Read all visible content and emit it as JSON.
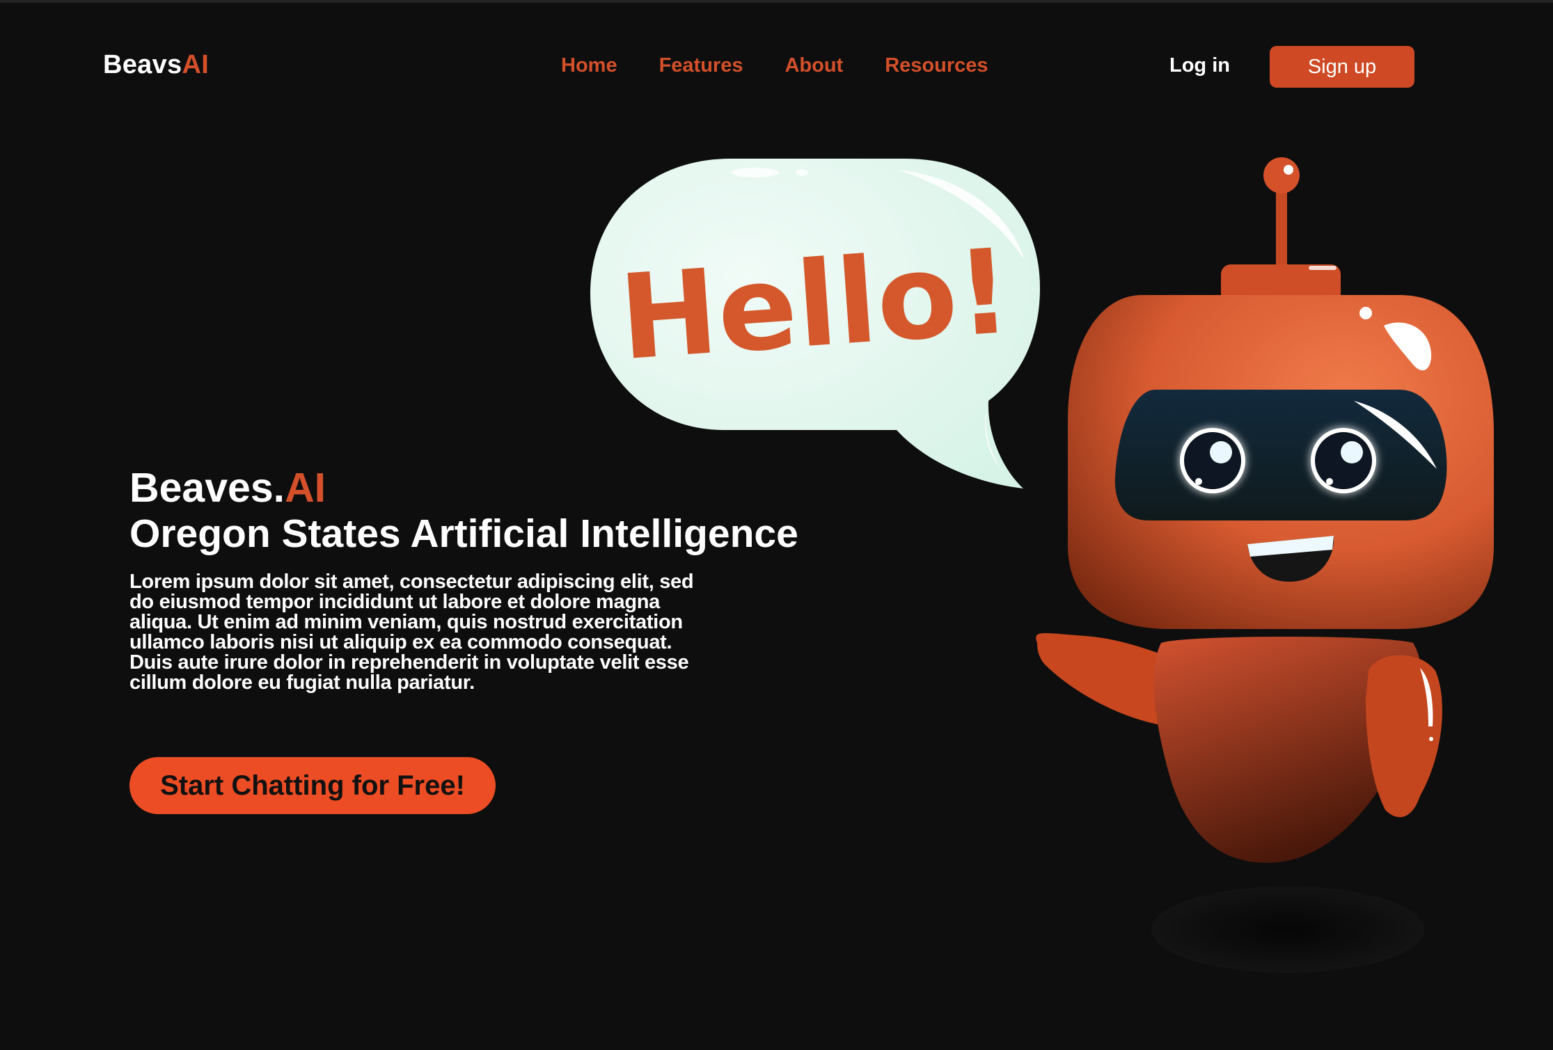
{
  "header": {
    "logo_main": "Beavs",
    "logo_accent": "AI",
    "nav": [
      "Home",
      "Features",
      "About",
      "Resources"
    ],
    "login_label": "Log in",
    "signup_label": "Sign up"
  },
  "hero": {
    "brand_main": "Beaves.",
    "brand_accent": "AI",
    "title": "Oregon States Artificial Intelligence",
    "description": "Lorem ipsum dolor sit amet, consectetur adipiscing elit, sed do eiusmod tempor incididunt ut labore et dolore magna aliqua. Ut enim ad minim veniam, quis nostrud exercitation ullamco laboris nisi ut aliquip ex ea commodo consequat. Duis aute irure dolor in reprehenderit in voluptate velit esse cillum dolore eu fugiat nulla pariatur.",
    "cta_label": "Start Chatting for Free!"
  },
  "illustration": {
    "bubble_text": "Hello!",
    "icon": "robot-mascot-icon"
  },
  "colors": {
    "background": "#0e0e0e",
    "accent": "#d4502a",
    "cta": "#ec4d24",
    "bubble": "#e2f6ee"
  }
}
